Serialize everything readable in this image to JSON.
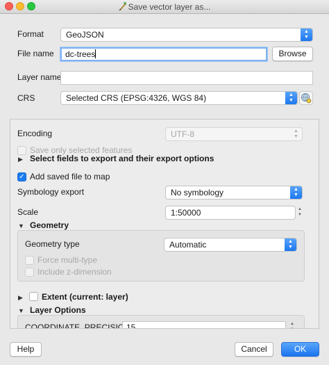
{
  "window": {
    "title": "Save vector layer as..."
  },
  "format": {
    "label": "Format",
    "value": "GeoJSON"
  },
  "file_name": {
    "label": "File name",
    "value": "dc-trees",
    "browse_label": "Browse"
  },
  "layer_name": {
    "label": "Layer name",
    "value": ""
  },
  "crs": {
    "label": "CRS",
    "value": "Selected CRS (EPSG:4326, WGS 84)"
  },
  "encoding": {
    "label": "Encoding",
    "value": "UTF-8"
  },
  "save_selected": {
    "label": "Save only selected features",
    "checked": false,
    "enabled": false
  },
  "select_fields": {
    "label": "Select fields to export and their export options"
  },
  "add_saved": {
    "label": "Add saved file to map",
    "checked": true
  },
  "symbology": {
    "label": "Symbology export",
    "value": "No symbology"
  },
  "scale": {
    "label": "Scale",
    "value": "1:50000"
  },
  "geometry": {
    "section_label": "Geometry",
    "type_label": "Geometry type",
    "type_value": "Automatic",
    "force_multi_label": "Force multi-type",
    "z_dimension_label": "Include z-dimension"
  },
  "extent": {
    "label": "Extent (current: layer)",
    "checked": false
  },
  "layer_options": {
    "section_label": "Layer Options",
    "coordinate_precision_label": "COORDINATE_PRECISION",
    "coordinate_precision_value": "15"
  },
  "buttons": {
    "help": "Help",
    "cancel": "Cancel",
    "ok": "OK"
  },
  "colors": {
    "accent": "#1a75ee",
    "close": "#fc5f57",
    "minimize": "#fdbc2e",
    "maximize": "#28c840"
  }
}
